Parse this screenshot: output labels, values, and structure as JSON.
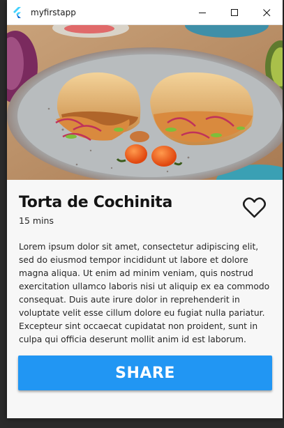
{
  "window": {
    "title": "myfirstapp",
    "logo_icon": "flutter-logo-icon",
    "controls": [
      "minimize-icon",
      "maximize-icon",
      "close-icon"
    ]
  },
  "recipe": {
    "image_alt": "Torta de Cochinita sandwich on plate",
    "title": "Torta de Cochinita",
    "duration": "15 mins",
    "favorite_icon": "heart-outline-icon",
    "description": "Lorem ipsum dolor sit amet, consectetur adipiscing elit, sed do eiusmod tempor incididunt ut labore et dolore magna aliqua. Ut enim ad minim veniam, quis nostrud exercitation ullamco laboris nisi ut aliquip ex ea commodo consequat. Duis aute irure dolor in reprehenderit in voluptate velit esse cillum dolore eu fugiat nulla pariatur. Excepteur sint occaecat cupidatat non proident, sunt in culpa qui officia deserunt mollit anim id est laborum.",
    "share_label": "SHARE"
  },
  "colors": {
    "accent": "#2196f3",
    "title_bar": "#ffffff",
    "background": "#f7f7f7"
  }
}
